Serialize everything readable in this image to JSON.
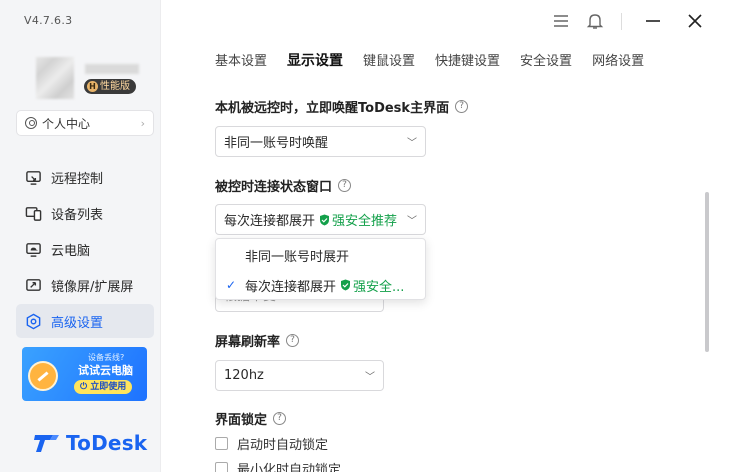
{
  "app": {
    "version": "V4.7.6.3",
    "badge_label": "性能版",
    "badge_mark": "H",
    "brand": "ToDesk"
  },
  "sidebar": {
    "profile_label": "个人中心",
    "items": [
      {
        "label": "远程控制",
        "icon": "remote-control-icon",
        "active": false
      },
      {
        "label": "设备列表",
        "icon": "device-list-icon",
        "active": false
      },
      {
        "label": "云电脑",
        "icon": "cloud-pc-icon",
        "active": false
      },
      {
        "label": "镜像屏/扩展屏",
        "icon": "mirror-screen-icon",
        "active": false
      },
      {
        "label": "高级设置",
        "icon": "advanced-settings-icon",
        "active": true
      }
    ],
    "promo": {
      "line1": "设备丢线?",
      "line2": "试试云电脑",
      "button": "立即使用"
    }
  },
  "titlebar": {
    "icons": [
      "menu-icon",
      "bell-icon",
      "minimize-icon",
      "close-icon"
    ]
  },
  "tabs": [
    {
      "label": "基本设置",
      "active": false
    },
    {
      "label": "显示设置",
      "active": true
    },
    {
      "label": "键鼠设置",
      "active": false
    },
    {
      "label": "快捷键设置",
      "active": false
    },
    {
      "label": "安全设置",
      "active": false
    },
    {
      "label": "网络设置",
      "active": false
    }
  ],
  "settings": {
    "wake": {
      "title": "本机被远控时，立即唤醒ToDesk主界面",
      "help": "?",
      "value": "非同一账号时唤醒"
    },
    "status_window": {
      "title": "被控时连接状态窗口",
      "help": "?",
      "value": "每次连接都展开",
      "tag": "强安全推荐",
      "options": [
        {
          "label": "非同一账号时展开",
          "selected": false,
          "tag": ""
        },
        {
          "label": "每次连接都展开",
          "selected": true,
          "tag": "强安全..."
        }
      ]
    },
    "occluded_select_text": "根据不变",
    "refresh_rate": {
      "title": "屏幕刷新率",
      "help": "?",
      "value": "120hz"
    },
    "lock": {
      "title": "界面锁定",
      "help": "?",
      "options": [
        {
          "label": "启动时自动锁定",
          "checked": false
        },
        {
          "label": "最小化时自动锁定",
          "checked": false
        }
      ]
    }
  },
  "colors": {
    "accent": "#1a64f0",
    "safe_green": "#13a04a",
    "sidebar_bg": "#f4f5f7"
  }
}
